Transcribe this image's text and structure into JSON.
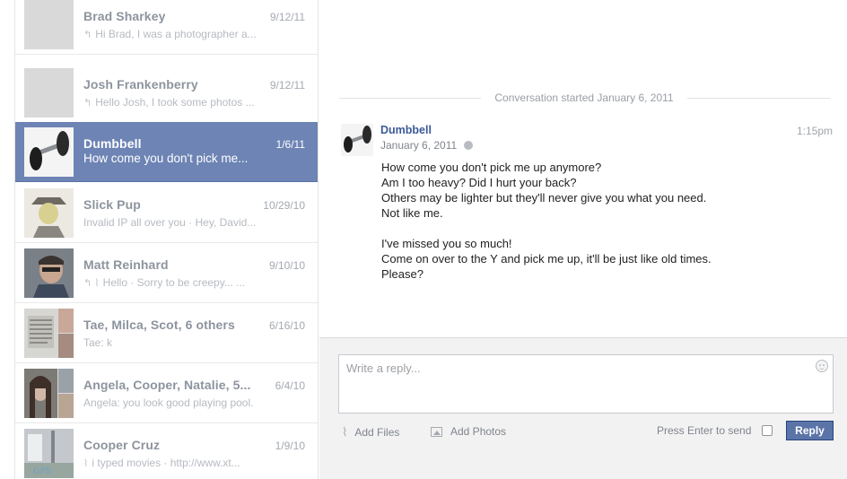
{
  "threads": [
    {
      "name": "Brad Sharkey",
      "date": "9/12/11",
      "snippet": "Hi Brad, I was a photographer a...",
      "glyph": "↰",
      "avatar": "photo-avatar"
    },
    {
      "name": "Josh Frankenberry",
      "date": "9/12/11",
      "snippet": "Hello Josh, I took some photos ...",
      "glyph": "↰",
      "avatar": "photo-avatar"
    },
    {
      "name": "Dumbbell",
      "date": "1/6/11",
      "snippet": "How come you don't pick me...",
      "glyph": "",
      "avatar": "dumbbell-avatar"
    },
    {
      "name": "Slick Pup",
      "date": "10/29/10",
      "snippet": "Invalid IP all over you · Hey, David...",
      "glyph": "",
      "avatar": "photo-avatar"
    },
    {
      "name": "Matt Reinhard",
      "date": "9/10/10",
      "snippet": "Hello · Sorry to be creepy... ...",
      "glyph": "↰ ⌇",
      "avatar": "photo-avatar"
    },
    {
      "name": "Tae, Milca, Scot, 6 others",
      "date": "6/16/10",
      "snippet": "Tae: k",
      "glyph": "",
      "avatar": "group-avatar"
    },
    {
      "name": "Angela, Cooper, Natalie, 5...",
      "date": "6/4/10",
      "snippet": "Angela: you look good playing pool.",
      "glyph": "",
      "avatar": "group-avatar"
    },
    {
      "name": "Cooper Cruz",
      "date": "1/9/10",
      "snippet": "i typed movies · http://www.xt...",
      "glyph": "⌇",
      "avatar": "photo-avatar"
    }
  ],
  "conversation": {
    "started": "Conversation started January 6, 2011",
    "sender": "Dumbbell",
    "time": "1:15pm",
    "date": "January 6, 2011",
    "lines": [
      "How come you don't pick me up anymore?",
      "Am I too heavy? Did I hurt your back?",
      "Others may be lighter but they'll never give you what you need.",
      "Not like me.",
      "",
      "I've missed you so much!",
      "Come on over to the Y and pick me up, it'll be just like old times.",
      "Please?"
    ]
  },
  "composer": {
    "placeholder": "Write a reply...",
    "add_files": "Add Files",
    "add_photos": "Add Photos",
    "press_enter": "Press Enter to send",
    "reply": "Reply"
  },
  "colors": {
    "selected": "#6d84b4",
    "link": "#3b5998",
    "reply_button": "#5b74a8"
  }
}
